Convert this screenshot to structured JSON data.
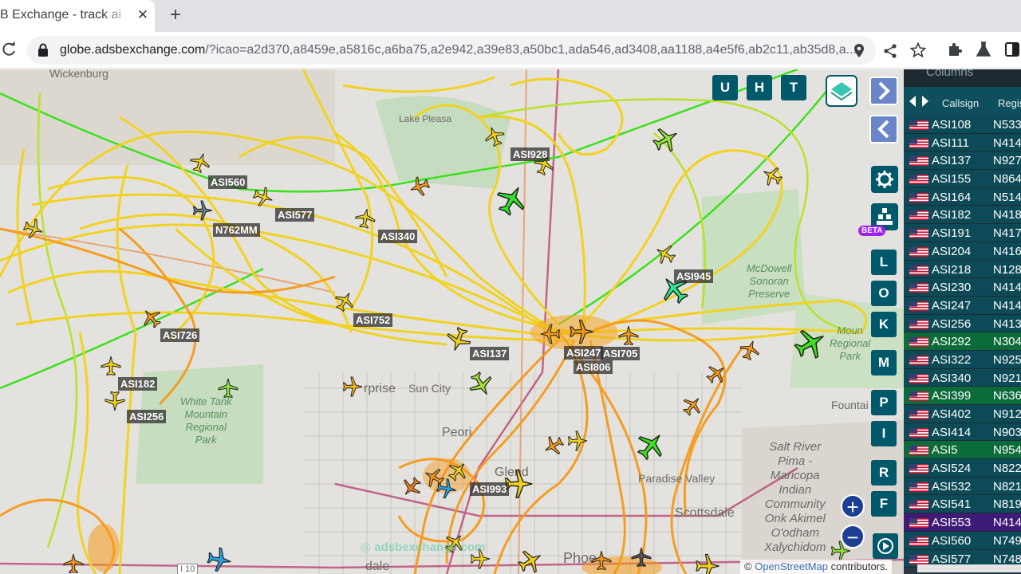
{
  "browser": {
    "tab_title": "B Exchange - track ai",
    "tab_close": "✕",
    "new_tab": "+",
    "url_host": "globe.adsbexchange.com",
    "url_rest": "/?icao=a2d370,a8459e,a5816c,a6ba75,a2e942,a39e83,a50bc1,ada546,ad3408,aa1188,a4e5f6,ab2c11,ab35d8,a..."
  },
  "map": {
    "places": {
      "wickenburg": "Wickenburg",
      "lake_pleasant": "Lake Pleasa",
      "sun_city": "Sun City",
      "surprise": "rprise",
      "peoria": "Peori",
      "glendale": "Glend",
      "phoenix": "Phoe",
      "paradise_valley": "Paradise Valley",
      "scottsdale": "Scottsdale",
      "fountain": "Fountai",
      "avondale": "dale",
      "freeway": "I 10"
    },
    "parks": {
      "mcdowell": "McDowell\nSonoran\nPreserve",
      "white_tank": "White Tank\nMountain\nRegional\nPark",
      "mountain_park": "Moun\nRegional\nPark"
    },
    "reservation": "Salt River\nPima -\nMaricopa\nIndian\nCommunity\nOnk Akimel\nO'odham\nXalychidom",
    "aircraft_labels": [
      "ASI560",
      "ASI577",
      "N762MM",
      "ASI340",
      "ASI928",
      "ASI945",
      "ASI752",
      "ASI726",
      "ASI137",
      "ASI247",
      "ASI705",
      "ASI806",
      "ASI182",
      "ASI256",
      "ASI993"
    ],
    "watermark": "adsbexchange.com",
    "attribution_prefix": "© ",
    "attribution_link": "OpenStreetMap",
    "attribution_suffix": " contributors."
  },
  "controls": {
    "u": "U",
    "h": "H",
    "t": "T",
    "beta": "BETA",
    "letters": [
      "L",
      "O",
      "K",
      "M",
      "P",
      "I",
      "R",
      "F"
    ]
  },
  "side_table": {
    "columns_label": "Columns",
    "headers": {
      "callsign": "Callsign",
      "registration": "Regis"
    },
    "rows": [
      {
        "cs": "ASI108",
        "reg": "N533"
      },
      {
        "cs": "ASI111",
        "reg": "N414"
      },
      {
        "cs": "ASI137",
        "reg": "N927"
      },
      {
        "cs": "ASI155",
        "reg": "N864"
      },
      {
        "cs": "ASI164",
        "reg": "N514"
      },
      {
        "cs": "ASI182",
        "reg": "N418"
      },
      {
        "cs": "ASI191",
        "reg": "N417"
      },
      {
        "cs": "ASI204",
        "reg": "N416"
      },
      {
        "cs": "ASI218",
        "reg": "N128"
      },
      {
        "cs": "ASI230",
        "reg": "N414"
      },
      {
        "cs": "ASI247",
        "reg": "N414"
      },
      {
        "cs": "ASI256",
        "reg": "N413"
      },
      {
        "cs": "ASI292",
        "reg": "N304"
      },
      {
        "cs": "ASI322",
        "reg": "N925"
      },
      {
        "cs": "ASI340",
        "reg": "N921"
      },
      {
        "cs": "ASI399",
        "reg": "N636"
      },
      {
        "cs": "ASI402",
        "reg": "N912"
      },
      {
        "cs": "ASI414",
        "reg": "N903"
      },
      {
        "cs": "ASI5",
        "reg": "N954"
      },
      {
        "cs": "ASI524",
        "reg": "N822"
      },
      {
        "cs": "ASI532",
        "reg": "N821"
      },
      {
        "cs": "ASI541",
        "reg": "N819"
      },
      {
        "cs": "ASI553",
        "reg": "N414"
      },
      {
        "cs": "ASI560",
        "reg": "N749"
      },
      {
        "cs": "ASI577",
        "reg": "N748"
      }
    ],
    "row_colors": {
      "ASI292": "green",
      "ASI399": "green",
      "ASI5": "green",
      "ASI553": "purple"
    }
  }
}
